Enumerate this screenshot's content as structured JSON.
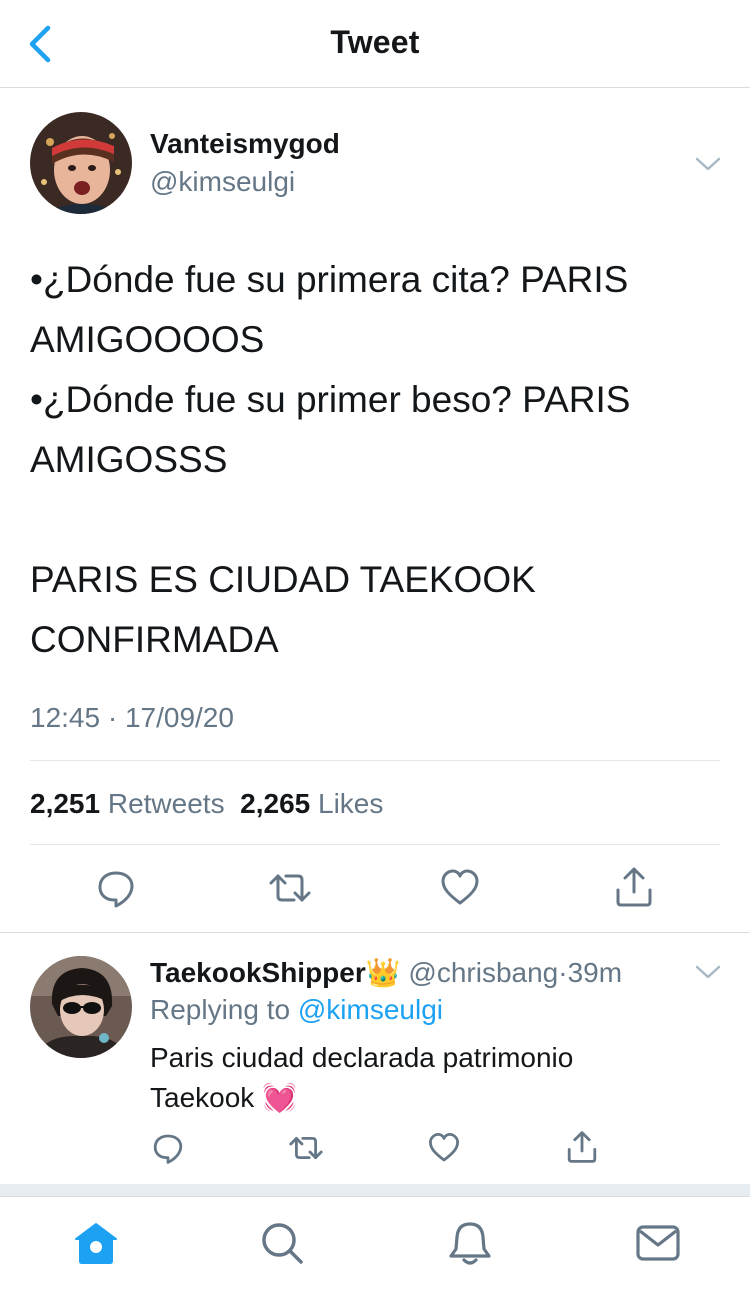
{
  "header": {
    "title": "Tweet",
    "back_icon": "chevron-left-icon"
  },
  "colors": {
    "accent": "#1da1f2",
    "secondary_text": "#657786",
    "text": "#14171a",
    "heart": "#ff4fa0"
  },
  "tweet": {
    "display_name": "Vanteismygod",
    "handle": "@kimseulgi",
    "lines": [
      "•¿Dónde fue su primera cita? PARIS",
      "AMIGOOOOS",
      "•¿Dónde fue su primer beso? PARIS",
      "AMIGOSSS",
      "",
      "PARIS ES CIUDAD TAEKOOK",
      "CONFIRMADA"
    ],
    "timestamp": "12:45 · 17/09/20",
    "retweets_count": "2,251",
    "retweets_label": "Retweets",
    "likes_count": "2,265",
    "likes_label": "Likes"
  },
  "reply": {
    "display_name": "TaekookShipper👑",
    "handle": "@chrisbang",
    "time": "·39m",
    "replying_label": "Replying to",
    "replying_to": "@kimseulgi",
    "text_line1": "Paris ciudad declarada patrimonio",
    "text_line2": "Taekook 💓"
  },
  "tabbar": {
    "items": [
      "home-icon",
      "search-icon",
      "notifications-icon",
      "messages-icon"
    ],
    "active": "home-icon"
  }
}
